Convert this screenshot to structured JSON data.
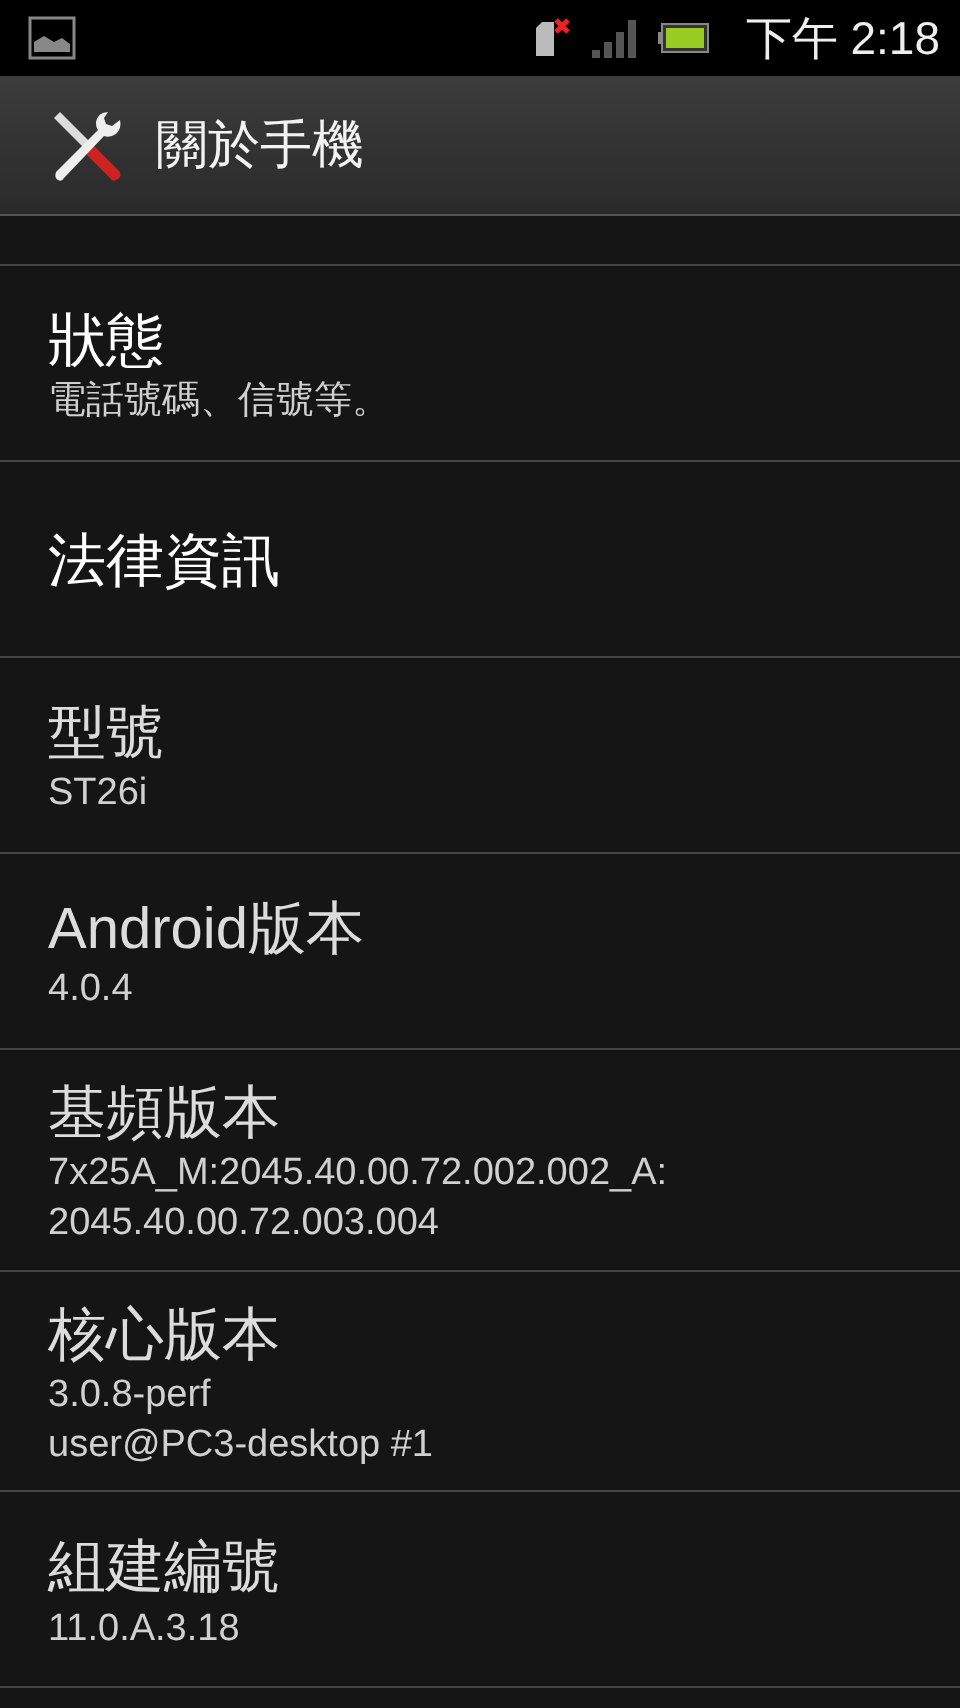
{
  "status_bar": {
    "time": "下午 2:18"
  },
  "action_bar": {
    "title": "關於手機"
  },
  "items": [
    {
      "kind": "link",
      "title": "狀態",
      "lines": [
        "電話號碼、信號等。"
      ]
    },
    {
      "kind": "link",
      "title": "法律資訊"
    },
    {
      "kind": "info",
      "title": "型號",
      "lines": [
        "ST26i"
      ]
    },
    {
      "kind": "info",
      "title": "Android版本",
      "lines": [
        "4.0.4"
      ]
    },
    {
      "kind": "info",
      "title": "基頻版本",
      "lines": [
        "7x25A_M:2045.40.00.72.002.002_A:",
        "2045.40.00.72.003.004"
      ]
    },
    {
      "kind": "info",
      "title": "核心版本",
      "lines": [
        "3.0.8-perf",
        "user@PC3-desktop #1"
      ]
    },
    {
      "kind": "info",
      "title": "組建編號",
      "lines": [
        "11.0.A.3.18"
      ]
    }
  ]
}
